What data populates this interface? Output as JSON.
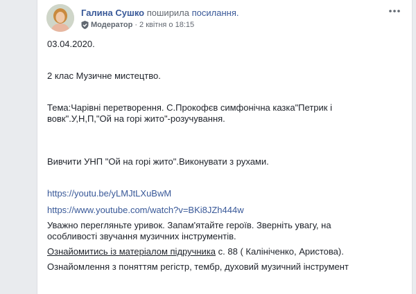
{
  "post": {
    "author": "Галина Сушко",
    "action": "поширила",
    "action_object": "посилання.",
    "role": "Модератор",
    "separator": "·",
    "time": "2 квітня о 18:15",
    "lines": {
      "date": "03.04.2020.",
      "class_subject": "2 клас Музичне мистецтво.",
      "topic_l1": "Тема:Чарівні перетворення. С.Прокофєв симфонічна казка\"Петрик і",
      "topic_l2": "вовк\".У,Н,П,\"Ой на горі жито\"-розучування.",
      "task": "Вивчити УНП \"Ой на горі жито\".Виконувати з рухами.",
      "link1": "https://youtu.be/yLMJtLXuBwM",
      "link2": "https://www.youtube.com/watch?v=BKi8JZh444w",
      "watch_l1": "Уважно перегляньте уривок. Запам'ятайте героїв. Зверніть увагу, на",
      "watch_l2": "особливості  звучання музичних інструментів.",
      "textbook_link": "Ознайомитись із матеріалом підручника",
      "textbook_rest": " с. 88 ( Калініченко, Аристова).",
      "terms": "Ознайомлення з поняттям регістр, тембр, духовий музичний інструмент"
    }
  },
  "colors": {
    "link": "#385898",
    "text": "#1d2129",
    "meta": "#616770",
    "background": "#e9ebee"
  },
  "icons": {
    "avatar": "user-photo",
    "moderator": "shield-check-icon",
    "more": "more-horizontal-icon"
  }
}
